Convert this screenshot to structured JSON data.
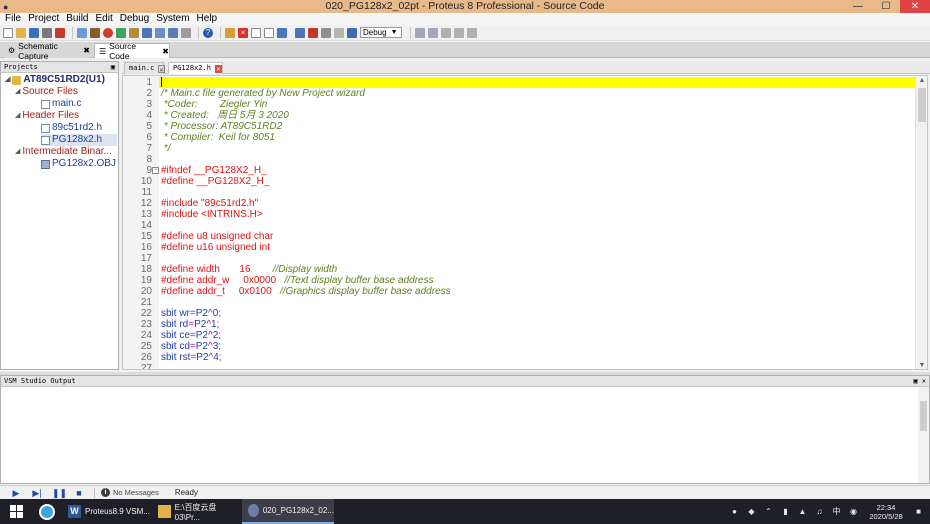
{
  "window": {
    "title": "020_PG128x2_02pt - Proteus 8 Professional - Source Code",
    "minimize": "—",
    "maximize": "☐",
    "close": "✕"
  },
  "menu": [
    "File",
    "Project",
    "Build",
    "Edit",
    "Debug",
    "System",
    "Help"
  ],
  "toolbar": {
    "build_config": "Debug"
  },
  "app_tabs": [
    {
      "label": "Schematic Capture",
      "close": "✖"
    },
    {
      "label": "Source Code",
      "close": "✖"
    }
  ],
  "projects_panel": {
    "title": "Projects",
    "root": "AT89C51RD2(U1)",
    "source_files": {
      "label": "Source Files",
      "items": [
        "main.c"
      ]
    },
    "header_files": {
      "label": "Header Files",
      "items": [
        "89c51rd2.h",
        "PG128x2.h"
      ]
    },
    "intermediate": {
      "label": "Intermediate Binar...",
      "items": [
        "PG128x2.OBJ"
      ]
    }
  },
  "editor_tabs": [
    {
      "label": "main.c",
      "close": "✕"
    },
    {
      "label": "PG128x2.h",
      "close": "✕"
    }
  ],
  "code_lines": [
    {
      "n": "1",
      "segs": []
    },
    {
      "n": "2",
      "segs": [
        {
          "t": "/* Main.c file generated by New Project wizard",
          "c": "comment"
        }
      ]
    },
    {
      "n": "3",
      "segs": [
        {
          "t": " *Coder:        Ziegler Yin",
          "c": "comment"
        }
      ]
    },
    {
      "n": "4",
      "segs": [
        {
          "t": " * Created:   周日 5月 3 2020",
          "c": "comment"
        }
      ]
    },
    {
      "n": "5",
      "segs": [
        {
          "t": " * Processor: AT89C51RD2",
          "c": "comment"
        }
      ]
    },
    {
      "n": "6",
      "segs": [
        {
          "t": " * Compiler:  Keil for 8051",
          "c": "comment"
        }
      ]
    },
    {
      "n": "7",
      "segs": [
        {
          "t": " */",
          "c": "comment"
        }
      ]
    },
    {
      "n": "8",
      "segs": []
    },
    {
      "n": "9",
      "segs": [
        {
          "t": "#ifndef __PG128X2_H_",
          "c": "pre"
        }
      ]
    },
    {
      "n": "10",
      "segs": [
        {
          "t": "#define __PG128X2_H_",
          "c": "pre"
        }
      ]
    },
    {
      "n": "11",
      "segs": []
    },
    {
      "n": "12",
      "segs": [
        {
          "t": "#include \"89c51rd2.h\"",
          "c": "pre"
        }
      ]
    },
    {
      "n": "13",
      "segs": [
        {
          "t": "#include <INTRINS.H>",
          "c": "pre"
        }
      ]
    },
    {
      "n": "14",
      "segs": []
    },
    {
      "n": "15",
      "segs": [
        {
          "t": "#define u8 unsigned char",
          "c": "pre"
        }
      ]
    },
    {
      "n": "16",
      "segs": [
        {
          "t": "#define u16 unsigned int",
          "c": "pre"
        }
      ]
    },
    {
      "n": "17",
      "segs": []
    },
    {
      "n": "18",
      "segs": [
        {
          "t": "#define width       16        ",
          "c": "pre"
        },
        {
          "t": "//Display width",
          "c": "comment"
        }
      ]
    },
    {
      "n": "19",
      "segs": [
        {
          "t": "#define addr_w     0x0000   ",
          "c": "pre"
        },
        {
          "t": "//Text display buffer base address",
          "c": "comment"
        }
      ]
    },
    {
      "n": "20",
      "segs": [
        {
          "t": "#define addr_t     0x0100   ",
          "c": "pre"
        },
        {
          "t": "//Graphics display buffer base address",
          "c": "comment"
        }
      ]
    },
    {
      "n": "21",
      "segs": []
    },
    {
      "n": "22",
      "segs": [
        {
          "t": "sbit wr",
          "c": "code"
        },
        {
          "t": "=",
          "c": "op"
        },
        {
          "t": "P2",
          "c": "code"
        },
        {
          "t": "^",
          "c": "op"
        },
        {
          "t": "0",
          "c": "code"
        },
        {
          "t": ";",
          "c": "op"
        }
      ]
    },
    {
      "n": "23",
      "segs": [
        {
          "t": "sbit rd",
          "c": "code"
        },
        {
          "t": "=",
          "c": "op"
        },
        {
          "t": "P2",
          "c": "code"
        },
        {
          "t": "^",
          "c": "op"
        },
        {
          "t": "1",
          "c": "code"
        },
        {
          "t": ";",
          "c": "op"
        }
      ]
    },
    {
      "n": "24",
      "segs": [
        {
          "t": "sbit ce",
          "c": "code"
        },
        {
          "t": "=",
          "c": "op"
        },
        {
          "t": "P2",
          "c": "code"
        },
        {
          "t": "^",
          "c": "op"
        },
        {
          "t": "2",
          "c": "code"
        },
        {
          "t": ";",
          "c": "op"
        }
      ]
    },
    {
      "n": "25",
      "segs": [
        {
          "t": "sbit cd",
          "c": "code"
        },
        {
          "t": "=",
          "c": "op"
        },
        {
          "t": "P2",
          "c": "code"
        },
        {
          "t": "^",
          "c": "op"
        },
        {
          "t": "3",
          "c": "code"
        },
        {
          "t": ";",
          "c": "op"
        }
      ]
    },
    {
      "n": "26",
      "segs": [
        {
          "t": "sbit rst",
          "c": "code"
        },
        {
          "t": "=",
          "c": "op"
        },
        {
          "t": "P2",
          "c": "code"
        },
        {
          "t": "^",
          "c": "op"
        },
        {
          "t": "4",
          "c": "code"
        },
        {
          "t": ";",
          "c": "op"
        }
      ]
    },
    {
      "n": "27",
      "segs": []
    }
  ],
  "output_panel": {
    "title": "VSM Studio Output"
  },
  "status": {
    "messages": "No Messages",
    "state": "Ready"
  },
  "taskbar": {
    "apps": [
      "Proteus8.9 VSM...",
      "E:\\百度云盘03\\Pr...",
      "020_PG128x2_02..."
    ],
    "word_letter": "W",
    "ime": "中",
    "time": "22:34",
    "date": "2020/5/28"
  },
  "colors": {
    "titlebar": "#e8b98a",
    "current_line": "#ffff00",
    "comment": "#5f7f1f",
    "preprocessor": "#e01313",
    "code": "#1f3da6"
  }
}
